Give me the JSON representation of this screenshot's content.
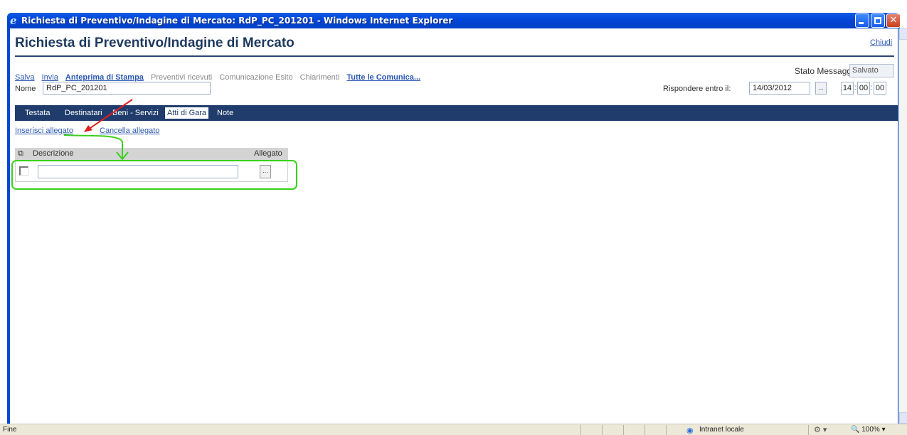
{
  "window": {
    "title": "Richiesta di Preventivo/Indagine di Mercato: RdP_PC_201201 - Windows Internet Explorer"
  },
  "page": {
    "title": "Richiesta di Preventivo/Indagine di Mercato",
    "close_label": "Chiudi"
  },
  "toolbar": {
    "salva": "Salva",
    "invia": "Invia",
    "anteprima": "Anteprima di Stampa",
    "preventivi": "Preventivi ricevuti",
    "comunicazione": "Comunicazione Esito",
    "chiarimenti": "Chiarimenti",
    "tutte": "Tutte le Comunica..."
  },
  "stato": {
    "label": "Stato Messaggio",
    "value": "Salvato"
  },
  "nome": {
    "label": "Nome",
    "value": "RdP_PC_201201"
  },
  "deadline": {
    "label": "Rispondere entro il:",
    "date": "14/03/2012",
    "picker": "...",
    "hour": "14",
    "minute": "00",
    "second": "00"
  },
  "tabs": [
    "Testata",
    "Destinatari",
    "Beni - Servizi",
    "Atti di Gara",
    "Note"
  ],
  "active_tab": "Atti di Gara",
  "actions": {
    "insert": "Inserisci allegato",
    "delete": "Cancella allegato"
  },
  "grid": {
    "header_icon": "copy-icon",
    "col_desc": "Descrizione",
    "col_attach": "Allegato",
    "row_button": "..."
  },
  "statusbar": {
    "text": "Fine",
    "zone": "Intranet locale",
    "zoom": "100%"
  },
  "colors": {
    "titlebar": "#0447d9",
    "tabbar": "#1f3c6c",
    "link": "#2b58b2",
    "annotation_red": "#e02020",
    "annotation_green": "#3ad01a"
  }
}
